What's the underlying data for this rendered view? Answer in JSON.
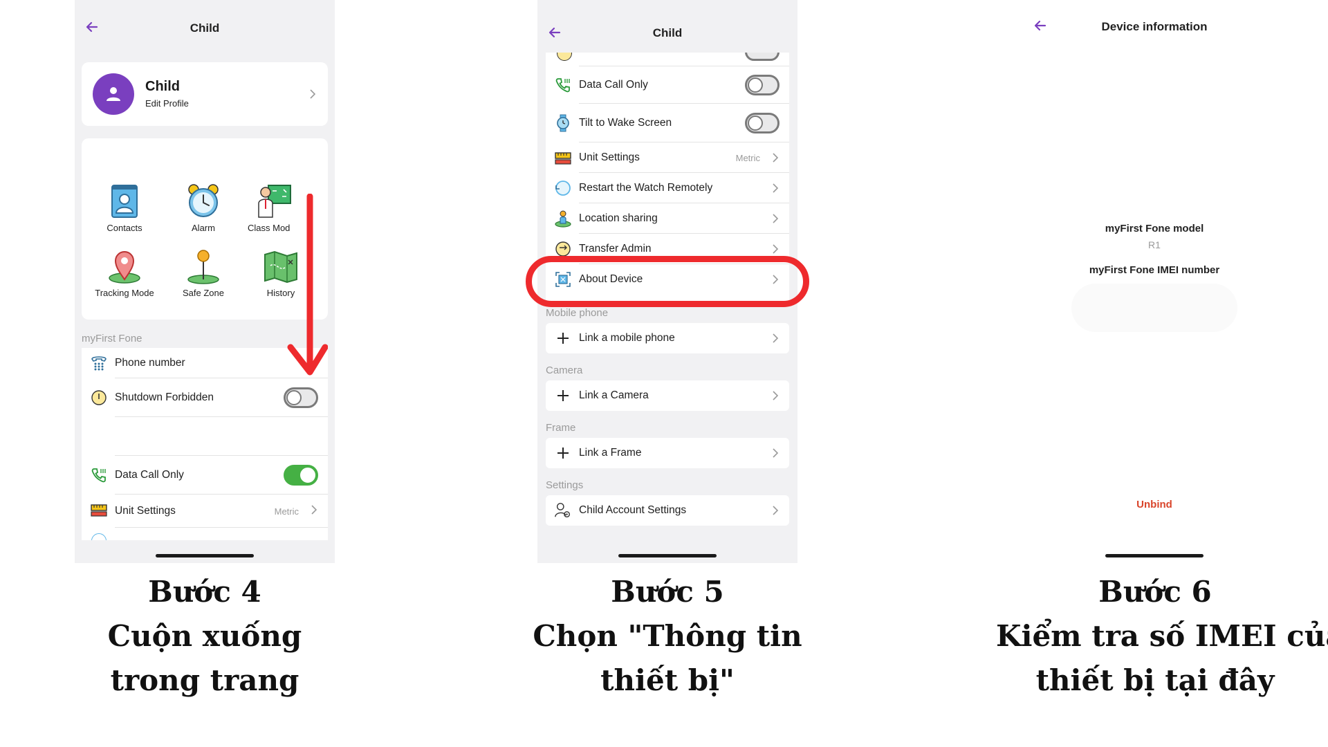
{
  "colors": {
    "accent": "#7a3fbf",
    "toggle_on": "#45b044",
    "highlight": "#ee2a2d",
    "unbind": "#d9452b"
  },
  "step4": {
    "title": "Child",
    "profile": {
      "name": "Child",
      "subtitle": "Edit Profile"
    },
    "grid": [
      {
        "label": "Contacts",
        "icon": "contacts-icon"
      },
      {
        "label": "Alarm",
        "icon": "alarm-clock-icon"
      },
      {
        "label": "Class Mod",
        "icon": "class-mode-icon"
      },
      {
        "label": "Tracking Mode",
        "icon": "location-pin-icon"
      },
      {
        "label": "Safe Zone",
        "icon": "safe-zone-icon"
      },
      {
        "label": "History",
        "icon": "map-icon"
      }
    ],
    "section": "myFirst Fone",
    "rows": {
      "phone_number": "Phone number",
      "shutdown_forbidden": "Shutdown Forbidden",
      "data_call_only": "Data Call Only",
      "unit_settings": "Unit Settings",
      "unit_value": "Metric"
    },
    "toggles": {
      "shutdown_forbidden": false,
      "data_call_only": true
    }
  },
  "step5": {
    "title": "Child",
    "rows": {
      "data_call_only": "Data Call Only",
      "tilt_to_wake": "Tilt to Wake Screen",
      "unit_settings": "Unit Settings",
      "unit_value": "Metric",
      "restart_watch": "Restart the Watch Remotely",
      "location_sharing": "Location sharing",
      "transfer_admin": "Transfer Admin",
      "about_device": "About Device"
    },
    "sections": {
      "mobile_phone": "Mobile phone",
      "link_mobile": "Link a mobile phone",
      "camera": "Camera",
      "link_camera": "Link a Camera",
      "frame": "Frame",
      "link_frame": "Link a Frame",
      "settings": "Settings",
      "child_account": "Child Account Settings"
    },
    "toggles": {
      "data_call_only": false,
      "tilt_to_wake": false
    }
  },
  "step6": {
    "title": "Device information",
    "model_label": "myFirst Fone model",
    "model_value": "R1",
    "imei_label": "myFirst Fone IMEI number",
    "unbind": "Unbind"
  },
  "captions": {
    "step4": [
      "Bước 4",
      "Cuộn xuống",
      "trong trang"
    ],
    "step5": [
      "Bước 5",
      "Chọn \"Thông tin",
      "thiết bị\""
    ],
    "step6": [
      "Bước 6",
      "Kiểm tra số IMEI của",
      "thiết bị tại đây"
    ]
  }
}
